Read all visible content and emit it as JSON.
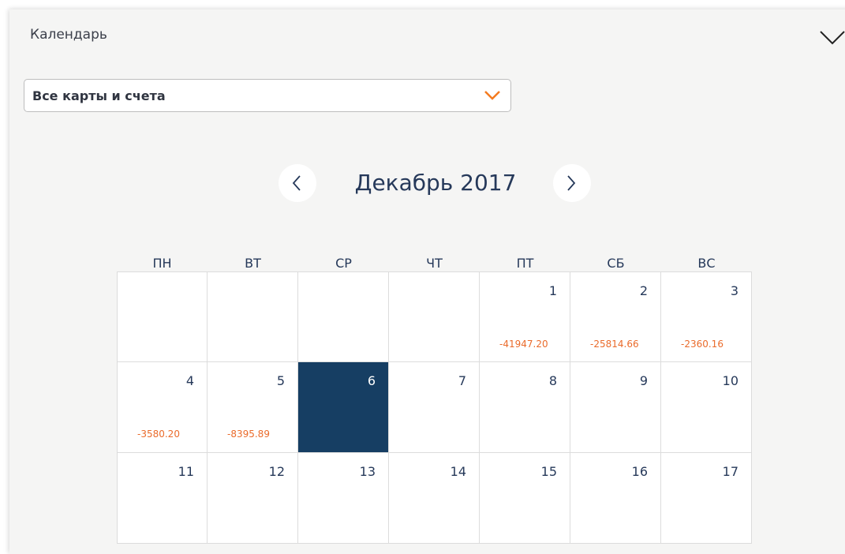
{
  "panel": {
    "title": "Календарь",
    "collapse_icon": "chevron-down-icon"
  },
  "account_select": {
    "value": "Все карты и счета",
    "chevron_icon": "chevron-down-icon",
    "accent_color": "#f47b20"
  },
  "calendar": {
    "month_label": "Декабрь 2017",
    "prev_icon": "chevron-left-icon",
    "next_icon": "chevron-right-icon",
    "weekdays": [
      "ПН",
      "ВТ",
      "СР",
      "ЧТ",
      "ПТ",
      "СБ",
      "ВС"
    ],
    "selected_color": "#163e63",
    "amount_color": "#ea6b2b",
    "weeks": [
      [
        {
          "day": "",
          "amount": ""
        },
        {
          "day": "",
          "amount": ""
        },
        {
          "day": "",
          "amount": ""
        },
        {
          "day": "",
          "amount": ""
        },
        {
          "day": "1",
          "amount": "-41947.20"
        },
        {
          "day": "2",
          "amount": "-25814.66"
        },
        {
          "day": "3",
          "amount": "-2360.16"
        }
      ],
      [
        {
          "day": "4",
          "amount": "-3580.20"
        },
        {
          "day": "5",
          "amount": "-8395.89"
        },
        {
          "day": "6",
          "amount": "",
          "selected": true
        },
        {
          "day": "7",
          "amount": ""
        },
        {
          "day": "8",
          "amount": ""
        },
        {
          "day": "9",
          "amount": ""
        },
        {
          "day": "10",
          "amount": ""
        }
      ],
      [
        {
          "day": "11",
          "amount": ""
        },
        {
          "day": "12",
          "amount": ""
        },
        {
          "day": "13",
          "amount": ""
        },
        {
          "day": "14",
          "amount": ""
        },
        {
          "day": "15",
          "amount": ""
        },
        {
          "day": "16",
          "amount": ""
        },
        {
          "day": "17",
          "amount": ""
        }
      ]
    ]
  }
}
